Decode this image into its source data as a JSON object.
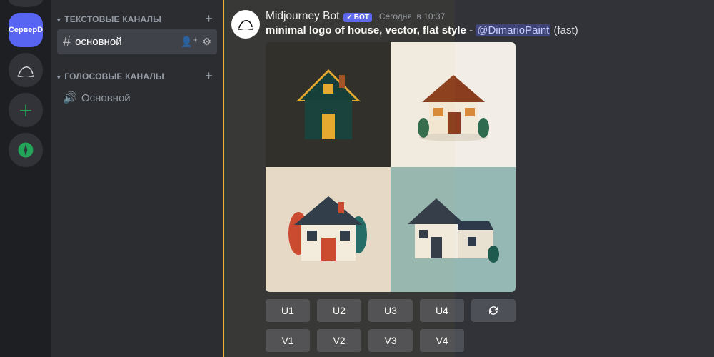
{
  "servers": {
    "active_label": "СерверD"
  },
  "sidebar": {
    "text_category": "ТЕКСТОВЫЕ КАНАЛЫ",
    "voice_category": "ГОЛОСОВЫЕ КАНАЛЫ",
    "text_channel": "основной",
    "voice_channel": "Основной"
  },
  "message": {
    "author": "Midjourney Bot",
    "bot_tag": "БОТ",
    "timestamp": "Сегодня, в 10:37",
    "prompt": "minimal logo of house, vector, flat style",
    "mention": "@DimarioPaint",
    "mode": "(fast)"
  },
  "buttons": {
    "upscale": [
      "U1",
      "U2",
      "U3",
      "U4"
    ],
    "variations": [
      "V1",
      "V2",
      "V3",
      "V4"
    ],
    "reroll_icon": "reroll"
  }
}
